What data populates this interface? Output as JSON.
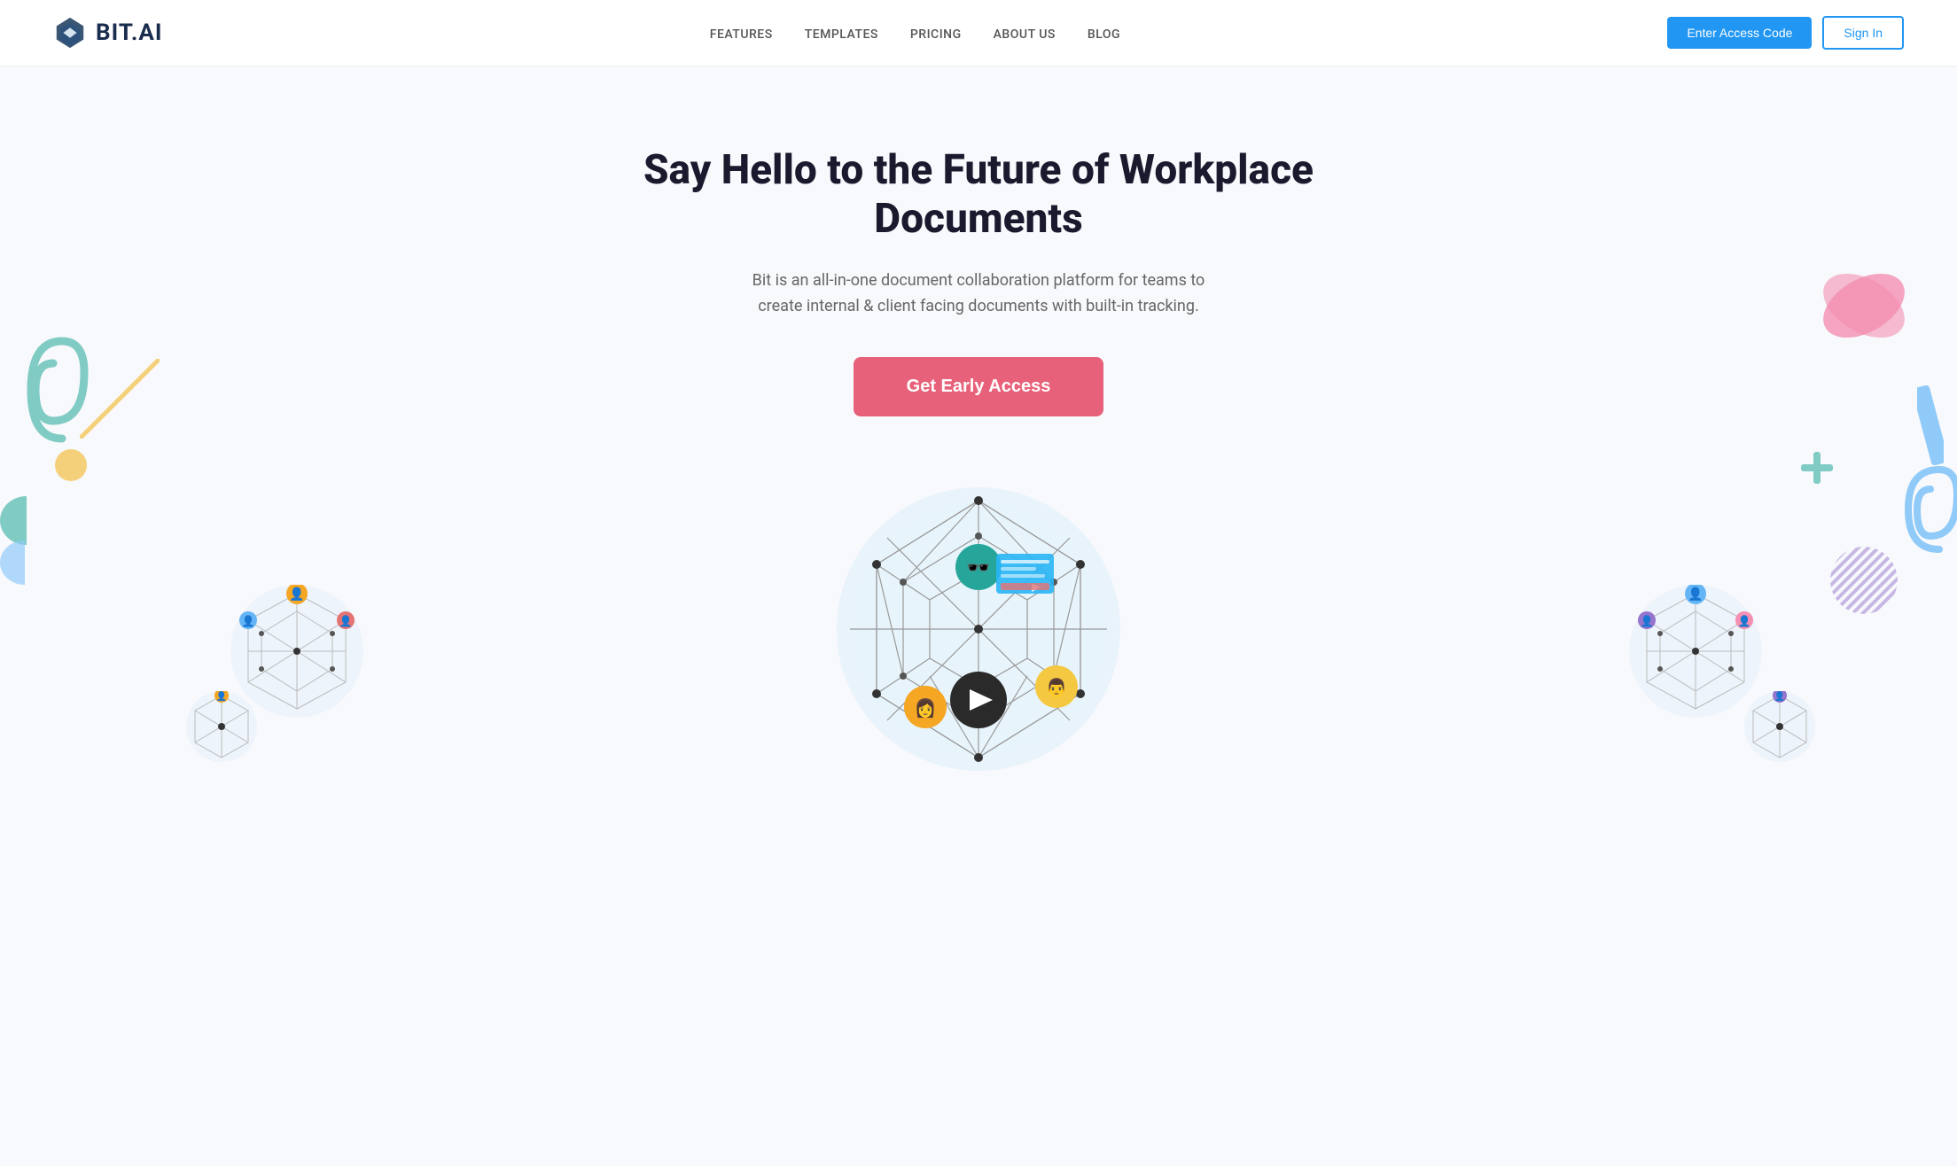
{
  "logo": {
    "text": "BIT.AI",
    "icon_alt": "bit-ai-logo"
  },
  "nav": {
    "links": [
      {
        "label": "FEATURES",
        "href": "#"
      },
      {
        "label": "TEMPLATES",
        "href": "#"
      },
      {
        "label": "PRICING",
        "href": "#"
      },
      {
        "label": "ABOUT US",
        "href": "#"
      },
      {
        "label": "BLOG",
        "href": "#"
      }
    ],
    "enter_access_label": "Enter Access Code",
    "sign_in_label": "Sign In"
  },
  "hero": {
    "title": "Say Hello to the Future of Workplace Documents",
    "subtitle": "Bit is an all-in-one document collaboration platform for teams to create internal & client facing documents with built-in tracking.",
    "cta_label": "Get Early Access"
  },
  "colors": {
    "accent_blue": "#2196f3",
    "accent_pink": "#e8617a",
    "teal": "#80cbc4",
    "yellow": "#f5d98b",
    "nav_text": "#555555",
    "hero_title": "#1a1a2e",
    "hero_subtitle": "#666666"
  }
}
